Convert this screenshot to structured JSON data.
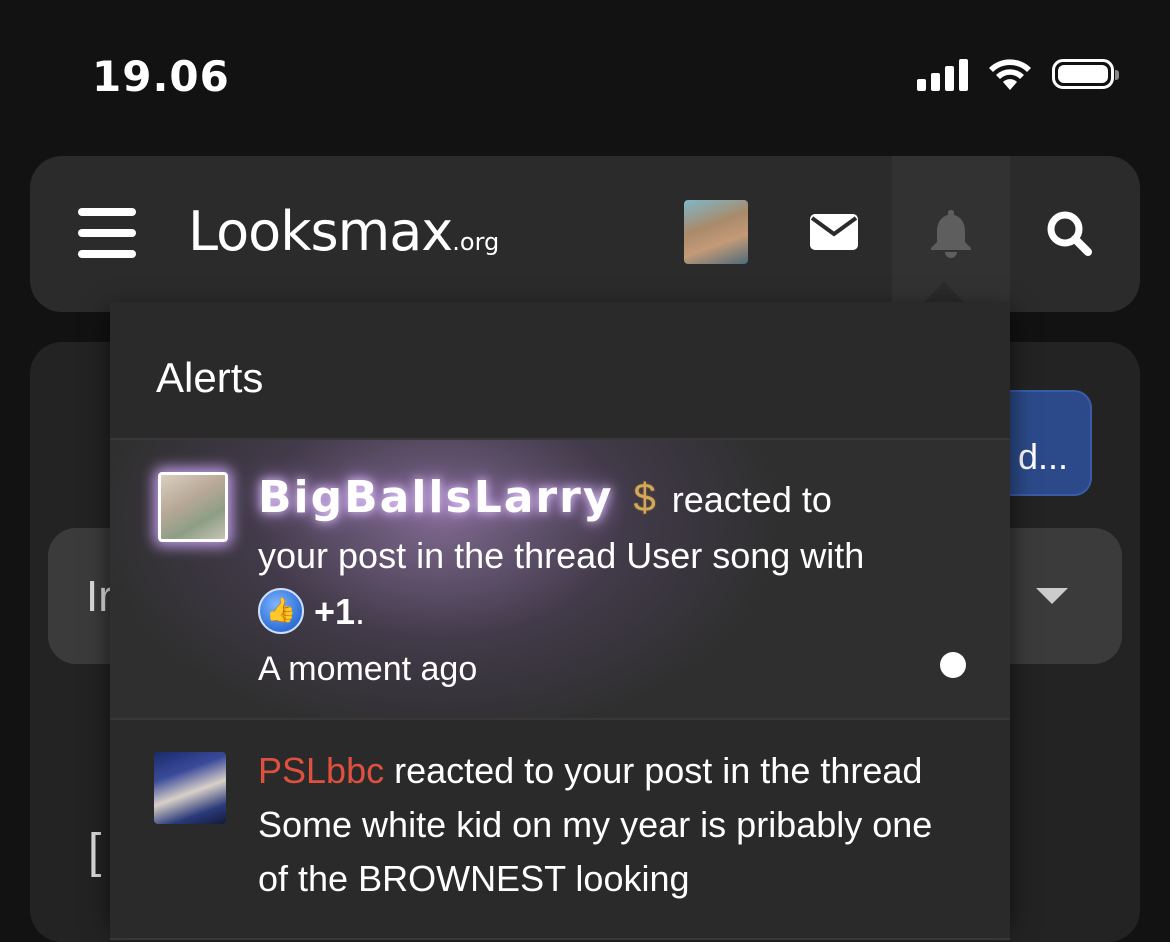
{
  "status_bar": {
    "time": "19.06"
  },
  "header": {
    "logo_main": "Looksmax",
    "logo_suffix": ".org"
  },
  "background": {
    "button_partial": "d...",
    "select_partial": "Ir",
    "bottom_partial": "["
  },
  "alerts": {
    "title": "Alerts",
    "items": [
      {
        "username": "BigBallsLarry",
        "badge": "$",
        "action": "reacted to",
        "message": "your post in the thread User song with",
        "reaction": "+1",
        "reaction_suffix": ".",
        "time": "A moment ago",
        "unread": true
      },
      {
        "username": "PSLbbc",
        "message": " reacted to your post in the thread Some white kid on my year is pribably one of the BROWNEST looking"
      }
    ]
  },
  "colors": {
    "username_red": "#e0503f",
    "badge_gold": "#d4a85a",
    "like_blue": "#2f6fd6"
  }
}
